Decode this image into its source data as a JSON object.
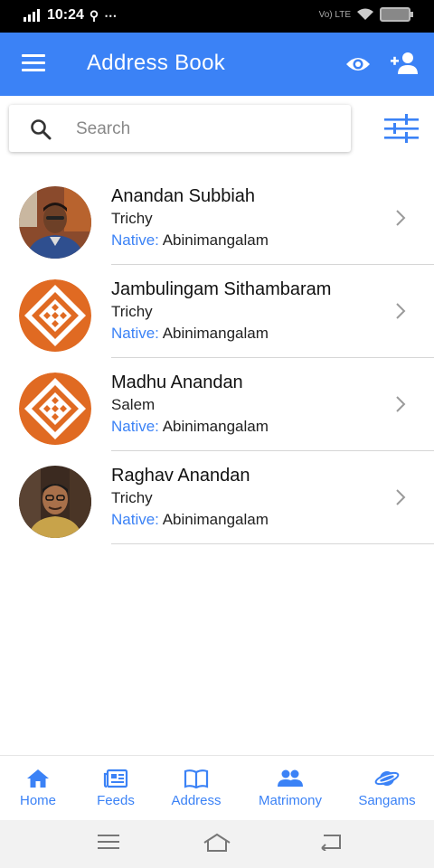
{
  "status_bar": {
    "network": "4G",
    "time": "10:24",
    "lte": "Vo) LTE"
  },
  "app_bar": {
    "title": "Address Book",
    "icons": [
      "menu-icon",
      "eye-icon",
      "add-user-icon"
    ]
  },
  "search": {
    "placeholder": "Search",
    "value": ""
  },
  "contacts": [
    {
      "name": "Anandan Subbiah",
      "city": "Trichy",
      "native_label": "Native:",
      "native": "Abinimangalam",
      "avatar": "photo"
    },
    {
      "name": "Jambulingam Sithambaram",
      "city": "Trichy",
      "native_label": "Native:",
      "native": "Abinimangalam",
      "avatar": "logo"
    },
    {
      "name": "Madhu Anandan",
      "city": "Salem",
      "native_label": "Native:",
      "native": "Abinimangalam",
      "avatar": "logo"
    },
    {
      "name": "Raghav Anandan",
      "city": "Trichy",
      "native_label": "Native:",
      "native": "Abinimangalam",
      "avatar": "photo"
    }
  ],
  "bottom_nav": [
    {
      "label": "Home",
      "icon": "home-icon"
    },
    {
      "label": "Feeds",
      "icon": "newspaper-icon"
    },
    {
      "label": "Address",
      "icon": "book-icon"
    },
    {
      "label": "Matrimony",
      "icon": "people-icon"
    },
    {
      "label": "Sangams",
      "icon": "planet-icon"
    }
  ],
  "colors": {
    "accent": "#3b82f6",
    "logo_orange": "#e06a22"
  }
}
